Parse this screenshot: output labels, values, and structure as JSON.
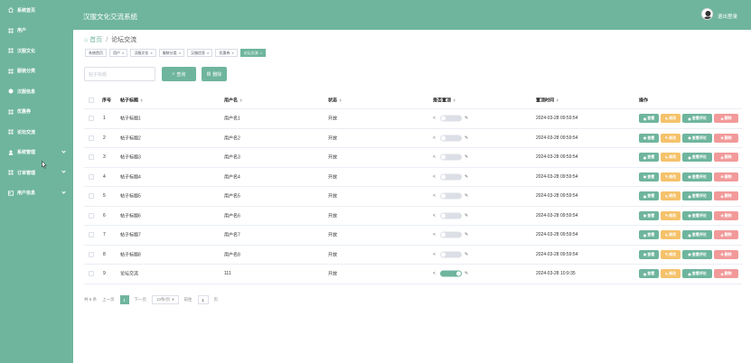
{
  "app": {
    "title": "汉服文化交流系统",
    "logout": "退出登录"
  },
  "sidebar": {
    "items": [
      {
        "label": "系统首页",
        "icon": "home-icon",
        "chevron": false
      },
      {
        "label": "用户",
        "icon": "grid-icon",
        "chevron": false
      },
      {
        "label": "汉服文化",
        "icon": "grid-icon",
        "chevron": false
      },
      {
        "label": "服装分类",
        "icon": "grid-icon",
        "chevron": false
      },
      {
        "label": "汉服信息",
        "icon": "shirt-icon",
        "chevron": false
      },
      {
        "label": "优惠券",
        "icon": "grid-icon",
        "chevron": false
      },
      {
        "label": "论坛交流",
        "icon": "grid-icon",
        "chevron": false
      },
      {
        "label": "系统管理",
        "icon": "user-icon",
        "chevron": true
      },
      {
        "label": "订单管理",
        "icon": "grid-icon",
        "chevron": true
      },
      {
        "label": "用户信息",
        "icon": "id-card-icon",
        "chevron": true
      }
    ]
  },
  "breadcrumb": {
    "home": "首页",
    "current": "论坛交流"
  },
  "tags": [
    {
      "label": "系统首页",
      "active": false,
      "closable": false
    },
    {
      "label": "用户",
      "active": false,
      "closable": true
    },
    {
      "label": "汉服文化",
      "active": false,
      "closable": true
    },
    {
      "label": "服装分类",
      "active": false,
      "closable": true
    },
    {
      "label": "汉服信息",
      "active": false,
      "closable": true
    },
    {
      "label": "优惠券",
      "active": false,
      "closable": true
    },
    {
      "label": "论坛交流",
      "active": true,
      "closable": true
    }
  ],
  "search": {
    "placeholder": "帖子标题",
    "search_label": "查询",
    "delete_label": "删除"
  },
  "table": {
    "headers": {
      "index": "序号",
      "title": "帖子标题",
      "username": "用户名",
      "status": "状态",
      "is_top": "是否置顶",
      "time": "置顶时间",
      "actions": "操作"
    },
    "action_labels": {
      "view": "查看",
      "edit": "修改",
      "comments": "查看评论",
      "delete": "删除"
    },
    "rows": [
      {
        "index": "1",
        "title": "帖子标题1",
        "username": "用户名1",
        "status": "开放",
        "top": false,
        "time": "2024-03-28 09:59:54"
      },
      {
        "index": "2",
        "title": "帖子标题2",
        "username": "用户名2",
        "status": "开放",
        "top": false,
        "time": "2024-03-28 09:59:54"
      },
      {
        "index": "3",
        "title": "帖子标题3",
        "username": "用户名3",
        "status": "开放",
        "top": false,
        "time": "2024-03-28 09:59:54"
      },
      {
        "index": "4",
        "title": "帖子标题4",
        "username": "用户名4",
        "status": "开放",
        "top": false,
        "time": "2024-03-28 09:59:54"
      },
      {
        "index": "5",
        "title": "帖子标题5",
        "username": "用户名5",
        "status": "开放",
        "top": false,
        "time": "2024-03-28 09:59:54"
      },
      {
        "index": "6",
        "title": "帖子标题6",
        "username": "用户名6",
        "status": "开放",
        "top": false,
        "time": "2024-03-28 09:59:54"
      },
      {
        "index": "7",
        "title": "帖子标题7",
        "username": "用户名7",
        "status": "开放",
        "top": false,
        "time": "2024-03-28 09:59:54"
      },
      {
        "index": "8",
        "title": "帖子标题8",
        "username": "用户名8",
        "status": "开放",
        "top": false,
        "time": "2024-03-28 09:59:54"
      },
      {
        "index": "9",
        "title": "论坛交流",
        "username": "111",
        "status": "开放",
        "top": true,
        "time": "2024-03-28 10:9:35"
      }
    ]
  },
  "pagination": {
    "total": "共 9 条",
    "prev": "上一页",
    "page": "1",
    "next": "下一页",
    "size": "10条/页",
    "goto": "前往",
    "goto_value": "1",
    "page_unit": "页"
  },
  "colors": {
    "primary": "#6fb59e",
    "warning": "#f5c26b",
    "danger": "#f29a9a"
  }
}
